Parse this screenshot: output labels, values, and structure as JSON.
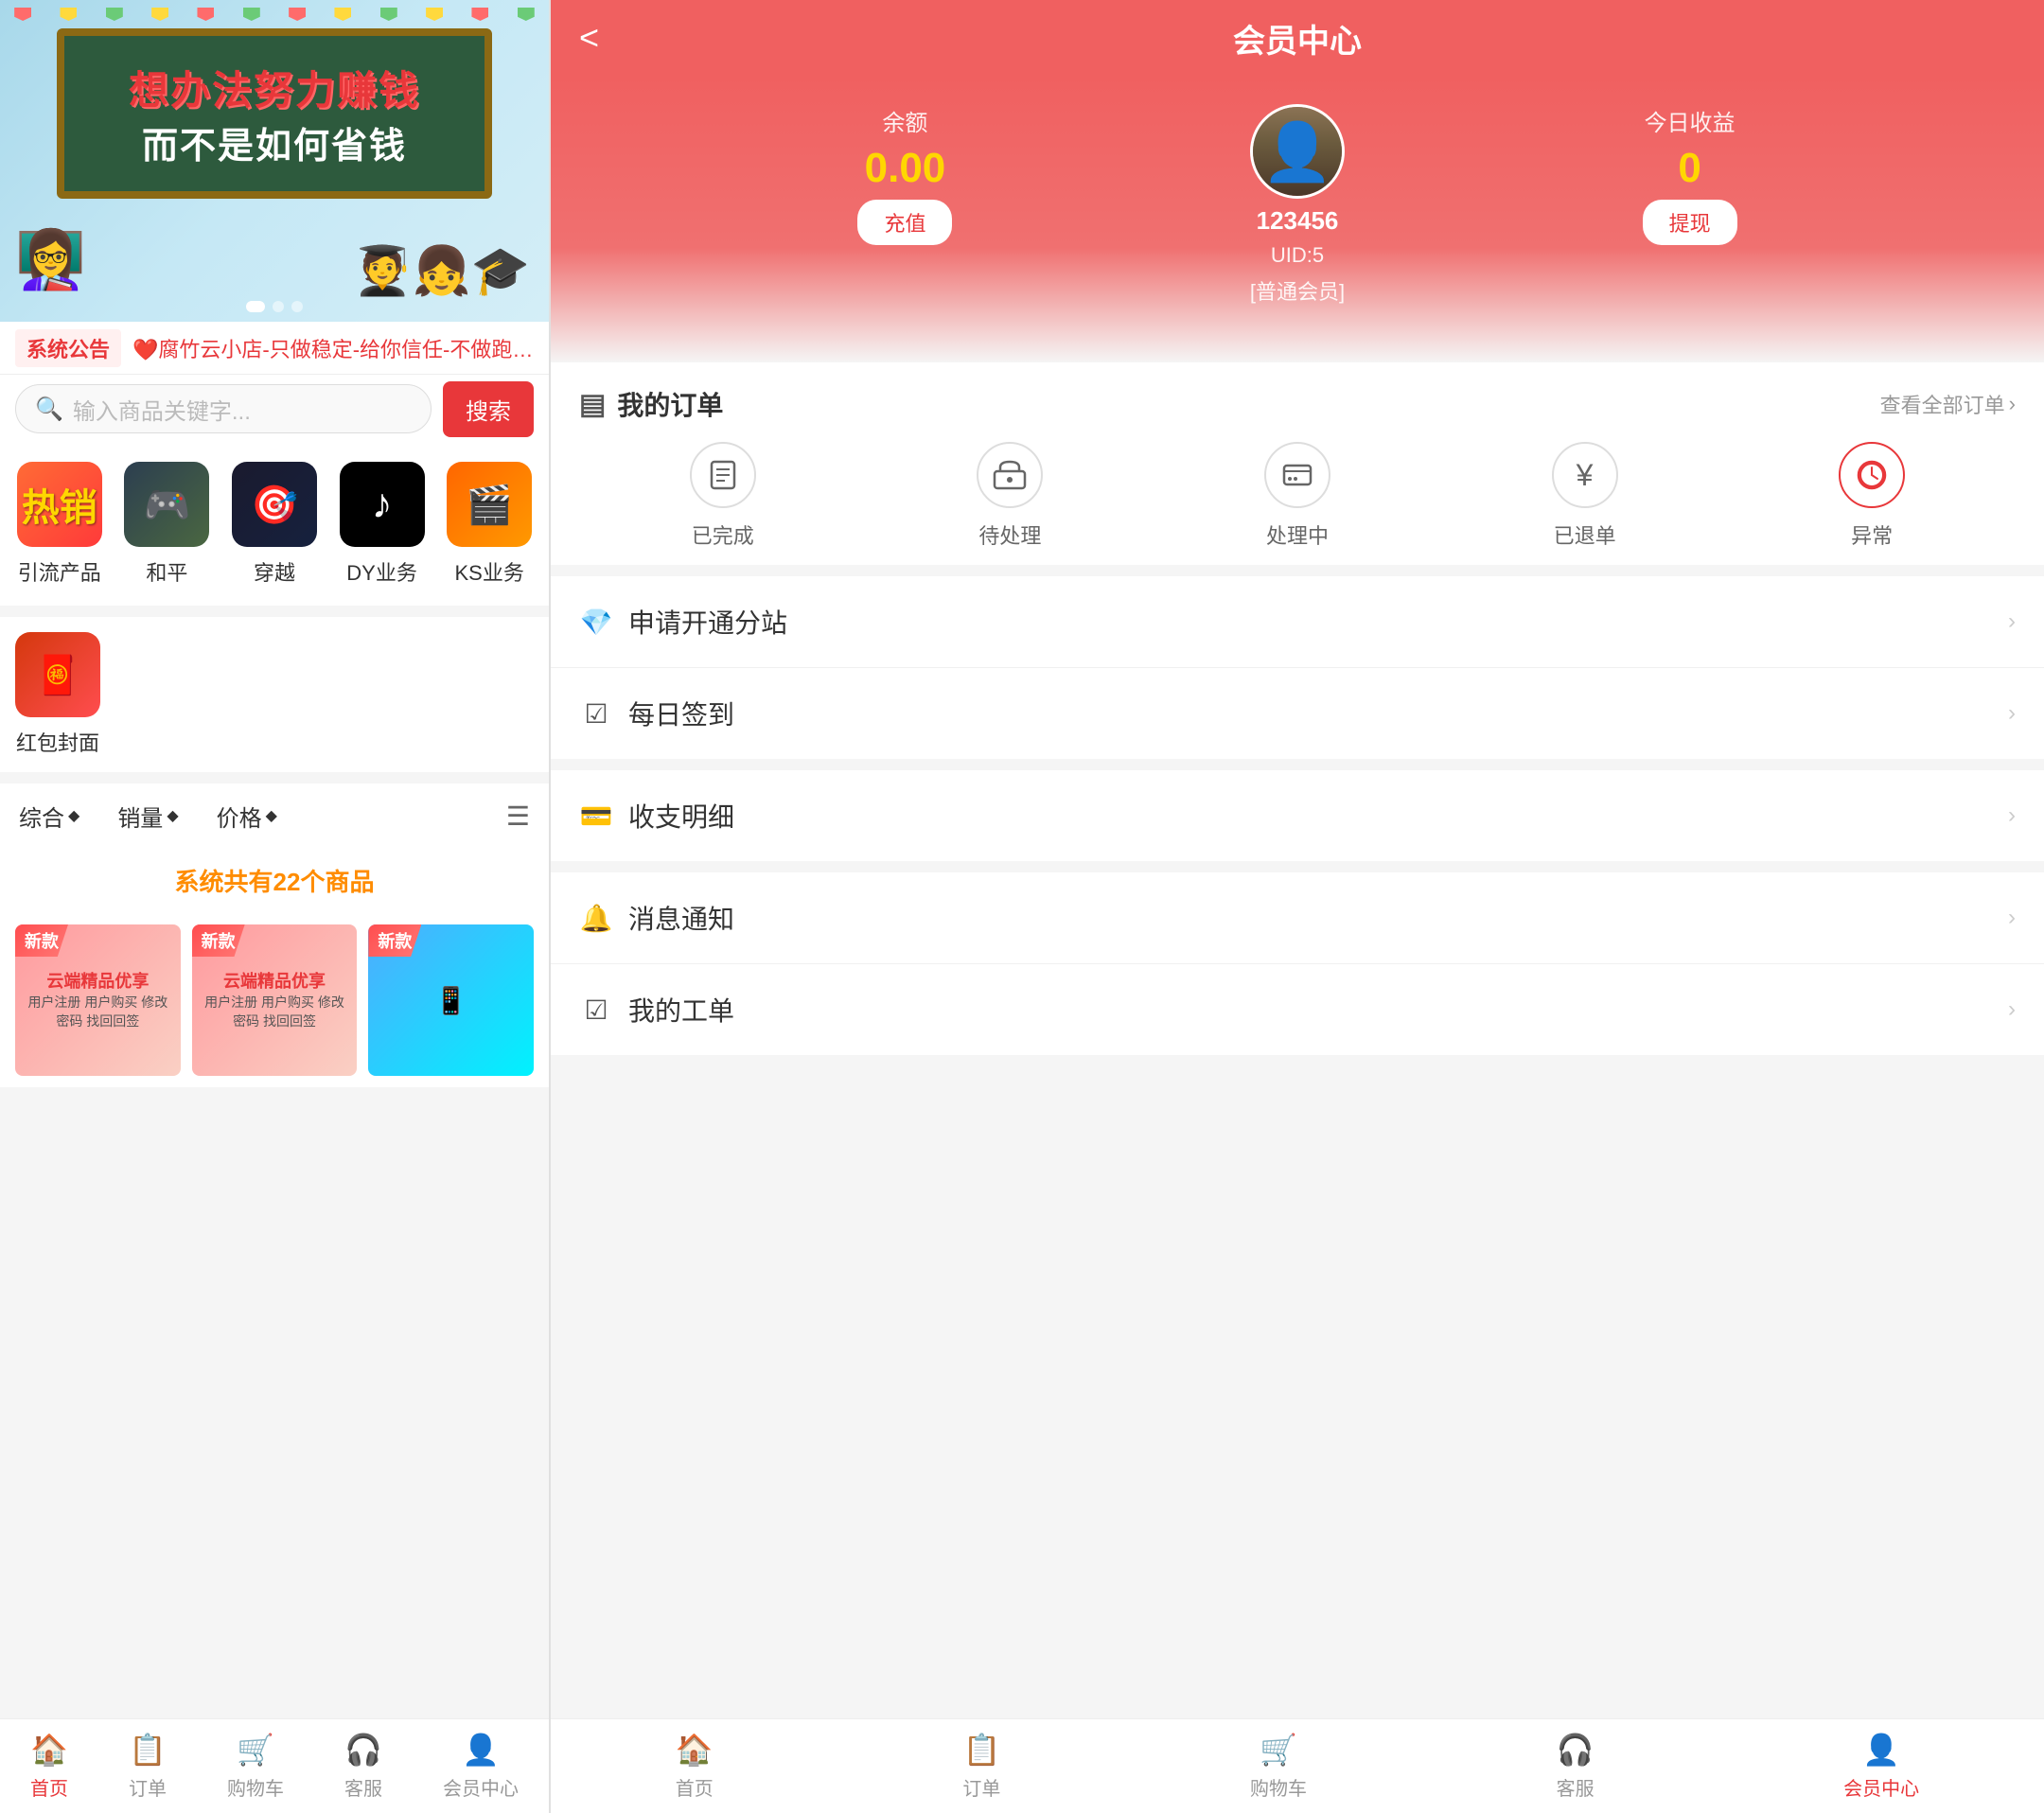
{
  "left": {
    "banner": {
      "text1": "想办法努力赚钱",
      "text2": "而不是如何省钱"
    },
    "notice": {
      "tag": "系统公告",
      "text": "❤️腐竹云小店-只做稳定-给你信任-不做跑路狗-售后稳定❤️"
    },
    "search": {
      "placeholder": "输入商品关键字...",
      "button": "搜索"
    },
    "categories": [
      {
        "label": "引流产品",
        "icon": "🔥",
        "bg": "cat-hot"
      },
      {
        "label": "和平",
        "icon": "🎮",
        "bg": "cat-peace"
      },
      {
        "label": "穿越",
        "icon": "🎯",
        "bg": "cat-cross"
      },
      {
        "label": "DY业务",
        "icon": "🎵",
        "bg": "cat-dy"
      },
      {
        "label": "KS业务",
        "icon": "🎬",
        "bg": "cat-ks"
      }
    ],
    "extra_category": {
      "label": "红包封面",
      "icon": "🧧"
    },
    "sort": {
      "items": [
        "综合",
        "销量",
        "价格"
      ],
      "diamond": "◆"
    },
    "products_header": "系统共有22个商品",
    "bottom_nav": [
      {
        "label": "首页",
        "icon": "🏠",
        "active": true
      },
      {
        "label": "订单",
        "icon": "📋",
        "active": false
      },
      {
        "label": "购物车",
        "icon": "🛒",
        "active": false
      },
      {
        "label": "客服",
        "icon": "🎧",
        "active": false
      },
      {
        "label": "会员中心",
        "icon": "👤",
        "active": false
      }
    ]
  },
  "right": {
    "header": {
      "title": "会员中心",
      "back": "<"
    },
    "user": {
      "name": "123456",
      "uid": "UID:5",
      "type": "[普通会员]",
      "balance_label": "余额",
      "balance": "0.00",
      "balance_btn": "充值",
      "earnings_label": "今日收益",
      "earnings": "0",
      "earnings_btn": "提现"
    },
    "orders": {
      "title": "我的订单",
      "view_all": "查看全部订单",
      "statuses": [
        {
          "label": "已完成",
          "icon": "💼"
        },
        {
          "label": "待处理",
          "icon": "🚚"
        },
        {
          "label": "处理中",
          "icon": "📦"
        },
        {
          "label": "已退单",
          "icon": "¥"
        },
        {
          "label": "异常",
          "icon": "⏰"
        }
      ]
    },
    "menu_items": [
      {
        "icon": "💎",
        "label": "申请开通分站",
        "arrow": ">"
      },
      {
        "icon": "☑️",
        "label": "每日签到",
        "arrow": ">"
      },
      {
        "icon": "💳",
        "label": "收支明细",
        "arrow": ">"
      },
      {
        "icon": "🔔",
        "label": "消息通知",
        "arrow": ">"
      },
      {
        "icon": "☑️",
        "label": "我的工单",
        "arrow": ">"
      }
    ],
    "bottom_nav": [
      {
        "label": "首页",
        "icon": "🏠",
        "active": false
      },
      {
        "label": "订单",
        "icon": "📋",
        "active": false
      },
      {
        "label": "购物车",
        "icon": "🛒",
        "active": false
      },
      {
        "label": "客服",
        "icon": "🎧",
        "active": false
      },
      {
        "label": "会员中心",
        "icon": "👤",
        "active": true
      }
    ]
  }
}
